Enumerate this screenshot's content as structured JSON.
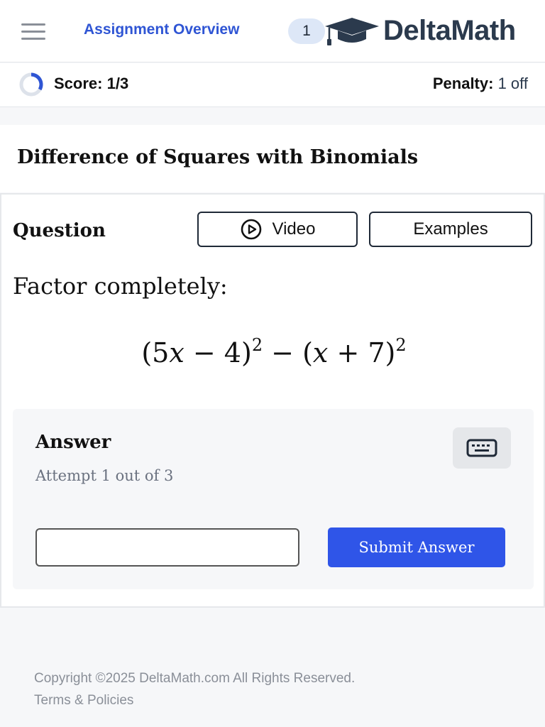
{
  "nav": {
    "menu_icon": "hamburger-menu-icon",
    "assignment_link": "Assignment Overview",
    "count": "1",
    "logo_text": "DeltaMath",
    "logo_icon": "graduation-cap-icon",
    "brand_color": "#2f55d4"
  },
  "score": {
    "label": "Score:",
    "value": "1/3",
    "progress_fraction": 0.333,
    "ring_color": "#2f55d4"
  },
  "penalty": {
    "label": "Penalty:",
    "value": "1 off"
  },
  "problem": {
    "title": "Difference of Squares with Binomials"
  },
  "question": {
    "label": "Question",
    "video_button": "Video",
    "video_icon": "play-circle-icon",
    "examples_button": "Examples",
    "prompt": "Factor completely:",
    "expression": {
      "part1": "(5",
      "var1": "x",
      "part2": " − 4)",
      "exp1": "2",
      "part3": " − (",
      "var2": "x",
      "part4": " + 7)",
      "exp2": "2"
    }
  },
  "answer": {
    "title": "Answer",
    "attempt_text": "Attempt 1 out of 3",
    "keyboard_icon": "keyboard-icon",
    "input_value": "",
    "input_placeholder": "",
    "submit_label": "Submit Answer",
    "submit_color": "#2f55e8"
  },
  "footer": {
    "copyright": "Copyright ©2025 DeltaMath.com All Rights Reserved.",
    "terms_link": "Terms & Policies"
  }
}
